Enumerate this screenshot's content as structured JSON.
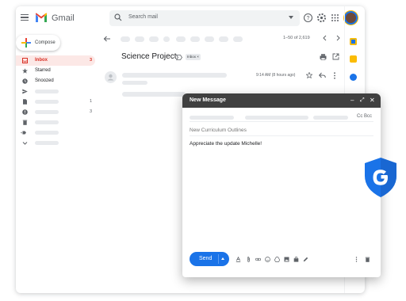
{
  "app": {
    "name": "Gmail"
  },
  "search": {
    "placeholder": "Search mail"
  },
  "compose_button": {
    "label": "Compose"
  },
  "nav": [
    {
      "label": "Inbox",
      "count": "3",
      "icon": "inbox-icon",
      "active": true
    },
    {
      "label": "Starred",
      "count": "",
      "icon": "star-icon"
    },
    {
      "label": "Snoozed",
      "count": "",
      "icon": "clock-icon"
    },
    {
      "label": "",
      "count": "",
      "icon": "send-icon"
    },
    {
      "label": "",
      "count": "1",
      "icon": "document-icon"
    },
    {
      "label": "",
      "count": "3",
      "icon": "alert-icon"
    },
    {
      "label": "",
      "count": "",
      "icon": "trash-icon"
    },
    {
      "label": "",
      "count": "",
      "icon": "label-icon"
    },
    {
      "label": "",
      "count": "",
      "icon": "expand-icon"
    }
  ],
  "pager": {
    "text": "1–50 of 2,619"
  },
  "thread": {
    "subject": "Science Project",
    "label_badge": "Inbox",
    "time": "9:14 AM (8 hours ago)"
  },
  "compose_window": {
    "title": "New Message",
    "cc_bcc": "Cc Bcc",
    "subject": "New Curriculum Outlines",
    "body": "Appreciate the update Michelle!",
    "send_label": "Send"
  },
  "colors": {
    "accent": "#1a73e8",
    "gmail_red": "#ea4335",
    "header_dark": "#404040",
    "shield_blue": "#1a73e8"
  }
}
